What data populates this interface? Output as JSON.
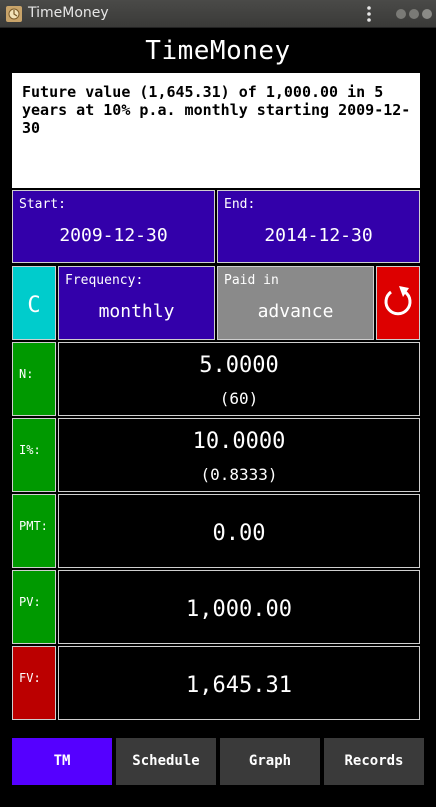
{
  "window": {
    "title": "TimeMoney"
  },
  "app": {
    "title": "TimeMoney"
  },
  "description": "Future value (1,645.31) of 1,000.00 in 5 years at 10% p.a. monthly starting 2009-12-30",
  "start": {
    "label": "Start:",
    "value": "2009-12-30"
  },
  "end": {
    "label": "End:",
    "value": "2014-12-30"
  },
  "clear": {
    "label": "C"
  },
  "frequency": {
    "label": "Frequency:",
    "value": "monthly"
  },
  "paid_in": {
    "label": "Paid in",
    "value": "advance"
  },
  "rows": {
    "n": {
      "label": "N:",
      "value": "5.0000",
      "sub": "(60)"
    },
    "i": {
      "label": "I%:",
      "value": "10.0000",
      "sub": "(0.8333)"
    },
    "pmt": {
      "label": "PMT:",
      "value": "0.00"
    },
    "pv": {
      "label": "PV:",
      "value": "1,000.00"
    },
    "fv": {
      "label": "FV:",
      "value": "1,645.31"
    }
  },
  "tabs": [
    {
      "label": "TM",
      "active": true
    },
    {
      "label": "Schedule",
      "active": false
    },
    {
      "label": "Graph",
      "active": false
    },
    {
      "label": "Records",
      "active": false
    }
  ],
  "colors": {
    "purple": "#3300aa",
    "cyan": "#00cccc",
    "gray": "#8a8a8a",
    "red": "#dd0000",
    "green": "#009900",
    "fv_red": "#bb0000",
    "tab_active": "#5500ff",
    "tab_inactive": "#3a3a3a"
  }
}
